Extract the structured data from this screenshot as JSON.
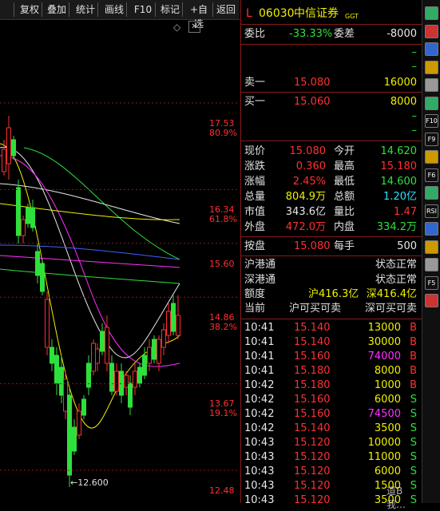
{
  "toolbar": {
    "buttons": [
      "复权",
      "叠加",
      "统计",
      "画线",
      "F10",
      "标记",
      "+自选",
      "返回"
    ],
    "close_glyph": "✕"
  },
  "chart": {
    "price_labels": [
      {
        "price": "17.53",
        "pct": "80.9%"
      },
      {
        "price": "16.34",
        "pct": "61.8%"
      },
      {
        "price": "15.60",
        "pct": ""
      },
      {
        "price": "14.86",
        "pct": "38.2%"
      },
      {
        "price": "13.67",
        "pct": "19.1%"
      },
      {
        "price": "12.48",
        "pct": ""
      }
    ],
    "low_annotation": "12.600",
    "diamond": "◇"
  },
  "stock": {
    "prefix": "L",
    "code": "06030",
    "name": "中信证券",
    "tag": "GGT"
  },
  "order_ratio": {
    "label": "委比",
    "value": "-33.33%",
    "diff_label": "委差",
    "diff_value": "-8000"
  },
  "ask": [
    {
      "label": "",
      "price": "",
      "vol": "–"
    },
    {
      "label": "",
      "price": "",
      "vol": "–"
    },
    {
      "label": "卖一",
      "price": "15.080",
      "vol": "16000"
    }
  ],
  "bid": [
    {
      "label": "买一",
      "price": "15.060",
      "vol": "8000"
    },
    {
      "label": "",
      "price": "",
      "vol": "–"
    },
    {
      "label": "",
      "price": "",
      "vol": "–"
    }
  ],
  "quote": [
    {
      "l1": "现价",
      "v1": "15.080",
      "c1": "red",
      "l2": "今开",
      "v2": "14.620",
      "c2": "green"
    },
    {
      "l1": "涨跌",
      "v1": "0.360",
      "c1": "red",
      "l2": "最高",
      "v2": "15.180",
      "c2": "red"
    },
    {
      "l1": "涨幅",
      "v1": "2.45%",
      "c1": "red",
      "l2": "最低",
      "v2": "14.600",
      "c2": "green"
    },
    {
      "l1": "总量",
      "v1": "804.9万",
      "c1": "yellow",
      "l2": "总额",
      "v2": "1.20亿",
      "c2": "cyan"
    },
    {
      "l1": "市值",
      "v1": "343.6亿",
      "c1": "white",
      "l2": "量比",
      "v2": "1.47",
      "c2": "red"
    },
    {
      "l1": "外盘",
      "v1": "472.0万",
      "c1": "red",
      "l2": "内盘",
      "v2": "334.2万",
      "c2": "green"
    }
  ],
  "lot": {
    "l1": "按盘",
    "v1": "15.080",
    "l2": "每手",
    "v2": "500"
  },
  "connect": [
    {
      "label": "沪港通",
      "value": "状态正常"
    },
    {
      "label": "深港通",
      "value": "状态正常"
    }
  ],
  "quota": {
    "label": "额度",
    "sh": "沪416.3亿",
    "sz": "深416.4亿"
  },
  "tradable": {
    "label": "当前",
    "sh": "沪可买可卖",
    "sz": "深可买可卖"
  },
  "ticks": [
    {
      "time": "10:41",
      "price": "15.140",
      "vol": "13000",
      "side": "B"
    },
    {
      "time": "10:41",
      "price": "15.140",
      "vol": "30000",
      "side": "B"
    },
    {
      "time": "10:41",
      "price": "15.160",
      "vol": "74000",
      "side": "B"
    },
    {
      "time": "10:41",
      "price": "15.180",
      "vol": "8000",
      "side": "B"
    },
    {
      "time": "10:42",
      "price": "15.180",
      "vol": "1000",
      "side": "B"
    },
    {
      "time": "10:42",
      "price": "15.160",
      "vol": "6000",
      "side": "S"
    },
    {
      "time": "10:42",
      "price": "15.160",
      "vol": "74500",
      "side": "S"
    },
    {
      "time": "10:42",
      "price": "15.140",
      "vol": "3500",
      "side": "S"
    },
    {
      "time": "10:43",
      "price": "15.120",
      "vol": "10000",
      "side": "S"
    },
    {
      "time": "10:43",
      "price": "15.120",
      "vol": "11000",
      "side": "S"
    },
    {
      "time": "10:43",
      "price": "15.120",
      "vol": "6000",
      "side": "S"
    },
    {
      "time": "10:43",
      "price": "15.120",
      "vol": "1500",
      "side": "S"
    },
    {
      "time": "10:43",
      "price": "15.120",
      "vol": "3500",
      "side": "S"
    }
  ],
  "watermark": "道B我…",
  "colors": {
    "up": "#ff3030",
    "down": "#2ee03c",
    "neutral": "#e8e8e8",
    "big_volume": "#ff30ff",
    "grid": "#8a1a1a"
  },
  "sidebar_icons": [
    "grid-icon",
    "list-icon",
    "table-icon",
    "line-chart-icon",
    "candle-chart-icon",
    "bar-chart-icon",
    "f10-icon",
    "f9-icon",
    "doc-icon",
    "f6-icon",
    "info-icon",
    "rsi-icon",
    "crossed-icon",
    "move-icon",
    "pen-icon",
    "f5-icon",
    "check-icon"
  ],
  "sidebar_labels": {
    "f10-icon": "F10",
    "f9-icon": "F9",
    "f6-icon": "F6",
    "rsi-icon": "RSI",
    "f5-icon": "F5"
  }
}
